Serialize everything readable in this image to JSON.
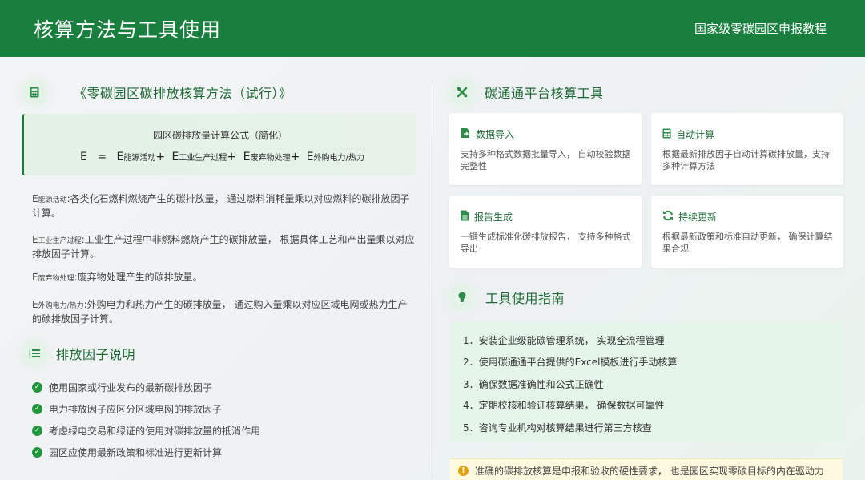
{
  "header": {
    "title": "核算方法与工具使用",
    "subtitle": "国家级零碳园区申报教程"
  },
  "left": {
    "method_title": "《零碳园区碳排放核算方法（试行）》",
    "formula": {
      "label": "园区碳排放量计算公式（简化）",
      "E": "E",
      "eq": "=",
      "terms": [
        {
          "sym": "E",
          "sub": "能源活动",
          "op": "+"
        },
        {
          "sym": "E",
          "sub": "工业生产过程",
          "op": "+"
        },
        {
          "sym": "E",
          "sub": "废弃物处理",
          "op": "+"
        },
        {
          "sym": "E",
          "sub": "外购电力/热力",
          "op": ""
        }
      ]
    },
    "definitions": [
      {
        "sym": "E",
        "sub": "能源活动",
        "text": ":各类化石燃料燃烧产生的碳排放量， 通过燃料消耗量乘以对应燃料的碳排放因子计算。"
      },
      {
        "sym": "E",
        "sub": "工业生产过程",
        "text": ":工业生产过程中非燃料燃烧产生的碳排放量， 根据具体工艺和产出量乘以对应排放因子计算。"
      },
      {
        "sym": "E",
        "sub": "废弃物处理",
        "text": ":废弃物处理产生的碳排放量。"
      },
      {
        "sym": "E",
        "sub": "外购电力/热力",
        "text": ":外购电力和热力产生的碳排放量， 通过购入量乘以对应区域电网或热力生产的碳排放因子计算。"
      }
    ],
    "factor_title": "排放因子说明",
    "factors": [
      "使用国家或行业发布的最新碳排放因子",
      "电力排放因子应区分区域电网的排放因子",
      "考虑绿电交易和绿证的使用对碳排放量的抵消作用",
      "园区应使用最新政策和标准进行更新计算"
    ]
  },
  "right": {
    "tool_title": "碳通通平台核算工具",
    "cards": [
      {
        "icon": "data-import-icon",
        "title": "数据导入",
        "desc": "支持多种格式数据批量导入， 自动校验数据完整性"
      },
      {
        "icon": "calculator-icon",
        "title": "自动计算",
        "desc": "根据最新排放因子自动计算碳排放量，支持多种计算方法"
      },
      {
        "icon": "report-icon",
        "title": "报告生成",
        "desc": "一键生成标准化碳排放报告， 支持多种格式导出"
      },
      {
        "icon": "refresh-icon",
        "title": "持续更新",
        "desc": "根据最新政策和标准自动更新， 确保计算结果合规"
      }
    ],
    "guide_title": "工具使用指南",
    "guide": [
      "1．安装企业级能碳管理系统， 实现全流程管理",
      "2．使用碳通通平台提供的Excel模板进行手动核算",
      "3．确保数据准确性和公式正确性",
      "4．定期校核和验证核算结果， 确保数据可靠性",
      "5．咨询专业机构对核算结果进行第三方核查"
    ],
    "note": "准确的碳排放核算是申报和验收的硬性要求， 也是园区实现零碳目标的内在驱动力"
  },
  "colors": {
    "brand_green": "#1a7e3e",
    "title_green": "#1d6a35",
    "check_green": "#22943e",
    "warning": "#e0a40e"
  }
}
